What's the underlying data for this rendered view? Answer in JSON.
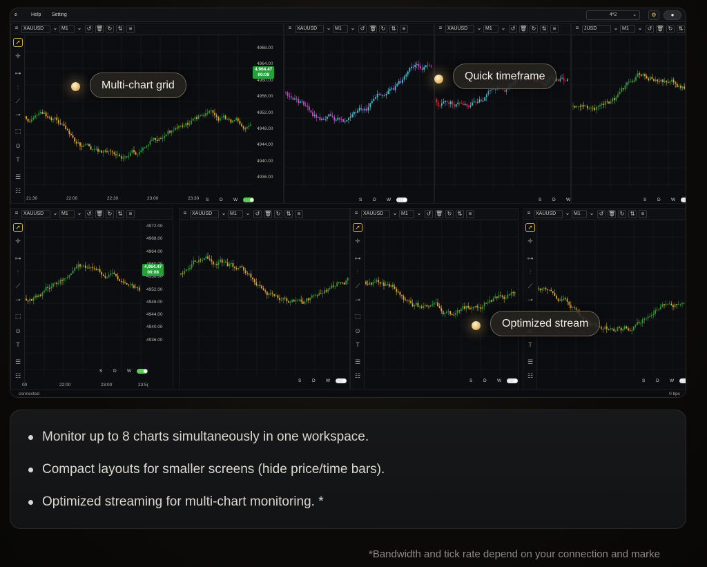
{
  "menu": {
    "items": [
      "e",
      "Help",
      "Setting"
    ]
  },
  "window_toolbar": {
    "layout_value": "4*2"
  },
  "panes": [
    {
      "symbol": "XAUUSD",
      "timeframe": "M1"
    },
    {
      "symbol": "XAUUSD",
      "timeframe": "M1"
    },
    {
      "symbol": "XAUUSD",
      "timeframe": "M1"
    },
    {
      "symbol": "JUSD",
      "timeframe": "M1"
    },
    {
      "symbol": "XAUUSD",
      "timeframe": "M1"
    },
    {
      "symbol": "XAUUSD",
      "timeframe": "M1"
    },
    {
      "symbol": "XAUUSD",
      "timeframe": "M1"
    },
    {
      "symbol": "XAUUSD",
      "timeframe": "M1"
    }
  ],
  "price_axis_top": [
    "4968.00",
    "4964.00",
    "4960.00",
    "4956.00",
    "4952.00",
    "4948.00",
    "4944.00",
    "4940.00",
    "4936.00"
  ],
  "price_axis_bottom": [
    "4972.00",
    "4968.00",
    "4964.00",
    "4960.00",
    "4956.00",
    "4952.00",
    "4948.00",
    "4944.00",
    "4940.00",
    "4936.00"
  ],
  "price_tag": {
    "price": "4,964.47",
    "countdown": "00:08"
  },
  "time_axis_top": [
    "21:30",
    "22:00",
    "22:30",
    "23:00",
    "23:30"
  ],
  "time_axis_bottom": [
    "00",
    "22:00",
    "23:00",
    "23:5("
  ],
  "period_buttons": [
    "S",
    "D",
    "W"
  ],
  "status": {
    "left": "connected",
    "right": "0 bps"
  },
  "callouts": {
    "grid": "Multi-chart grid",
    "timeframe": "Quick timeframe",
    "stream": "Optimized stream"
  },
  "features": [
    "Monitor up to 8 charts simultaneously in one workspace.",
    "Compact layouts for smaller screens (hide price/time bars).",
    "Optimized streaming for multi-chart monitoring. *"
  ],
  "footnote": "*Bandwidth and tick rate depend on your connection and marke",
  "colors": {
    "up": "#2e9c3a",
    "down": "#e0a92a",
    "magenta": "#d04ad8",
    "cyan": "#3fc6d6",
    "red": "#d8283a",
    "accent": "#d9a93a",
    "tag": "#26a03a"
  },
  "icons": [
    "hamburger-icon",
    "chevron-down-icon",
    "undo-icon",
    "trash-icon",
    "refresh-icon",
    "swap-icon",
    "list-icon",
    "cursor-icon",
    "crosshair-icon",
    "hline-icon",
    "vline-icon",
    "trendline-icon",
    "ray-icon",
    "rect-icon",
    "circle-icon",
    "text-icon",
    "gear-icon",
    "toggle-icon"
  ]
}
